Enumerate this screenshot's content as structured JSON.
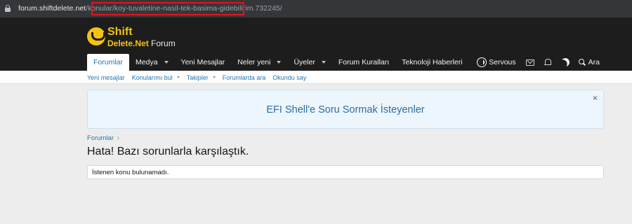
{
  "browser": {
    "url_host": "forum.shiftdelete.net",
    "url_path_part1": "/konul",
    "url_path_part2": "ar/koy-tuvaletine-nasil-tek-basima-gidebilirim.732245/",
    "highlight_color": "#e0151b"
  },
  "logo": {
    "line1": "Shift",
    "line2": "Delete.Net",
    "line3": "Forum"
  },
  "nav": {
    "items": [
      {
        "label": "Forumlar",
        "active": true,
        "dropdown": false
      },
      {
        "label": "Medya",
        "active": false,
        "dropdown": true
      },
      {
        "label": "Yeni Mesajlar",
        "active": false,
        "dropdown": false
      },
      {
        "label": "Neler yeni",
        "active": false,
        "dropdown": true
      },
      {
        "label": "Üyeler",
        "active": false,
        "dropdown": true
      },
      {
        "label": "Forum Kuralları",
        "active": false,
        "dropdown": false
      },
      {
        "label": "Teknoloji Haberleri",
        "active": false,
        "dropdown": false
      }
    ],
    "username": "Servous",
    "search_label": "Ara",
    "icons": [
      "avatar",
      "mail-icon",
      "bell-icon",
      "moon-icon",
      "search-icon"
    ]
  },
  "subnav": {
    "items": [
      {
        "label": "Yeni mesajlar",
        "dropdown": false
      },
      {
        "label": "Konularımı bul",
        "dropdown": true
      },
      {
        "label": "Takipler",
        "dropdown": true
      },
      {
        "label": "Forumlarda ara",
        "dropdown": false
      },
      {
        "label": "Okundu say",
        "dropdown": false
      }
    ]
  },
  "notice": {
    "text": "EFI Shell'e Soru Sormak İsteyenler",
    "close": "×"
  },
  "breadcrumb": {
    "label": "Forumlar",
    "separator": "›"
  },
  "page": {
    "title": "Hata! Bazı sorunlarla karşılaştık."
  },
  "message": {
    "text": "İstenen konu bulunamadı."
  },
  "colors": {
    "header_bg": "#1d1d1d",
    "accent": "#2577b1",
    "logo": "#f2c315",
    "page_bg": "#ededed"
  }
}
